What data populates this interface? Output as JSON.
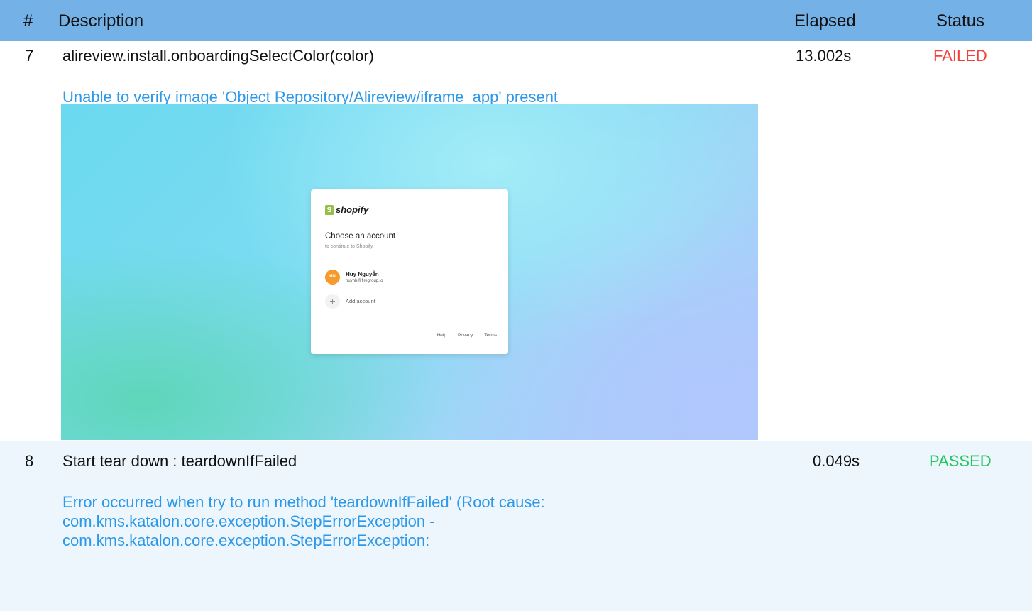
{
  "table": {
    "headers": {
      "num": "#",
      "description": "Description",
      "elapsed": "Elapsed",
      "status": "Status"
    },
    "rows": [
      {
        "num": "7",
        "description": "alireview.install.onboardingSelectColor(color)",
        "elapsed": "13.002s",
        "status": "FAILED",
        "message": "Unable to verify image 'Object Repository/Alireview/iframe_app' present",
        "screenshot": {
          "logo": "shopify",
          "title": "Choose an account",
          "subtitle": "to continue to Shopify",
          "account": {
            "initials": "HN",
            "name": "Huy Nguyễn",
            "email": "huynh@firegroup.io"
          },
          "add_account": "Add account",
          "links": [
            "Help",
            "Privacy",
            "Terms"
          ]
        }
      },
      {
        "num": "8",
        "description": "Start tear down : teardownIfFailed",
        "elapsed": "0.049s",
        "status": "PASSED",
        "message_lines": [
          "Error occurred when try to run method 'teardownIfFailed' (Root cause:",
          "com.kms.katalon.core.exception.StepErrorException -",
          "com.kms.katalon.core.exception.StepErrorException:"
        ]
      }
    ]
  },
  "colors": {
    "header_bg": "#73b1e6",
    "failed": "#f0423c",
    "passed": "#22c55e",
    "message": "#2c98e8",
    "row_alt_bg": "#eef6fd"
  }
}
